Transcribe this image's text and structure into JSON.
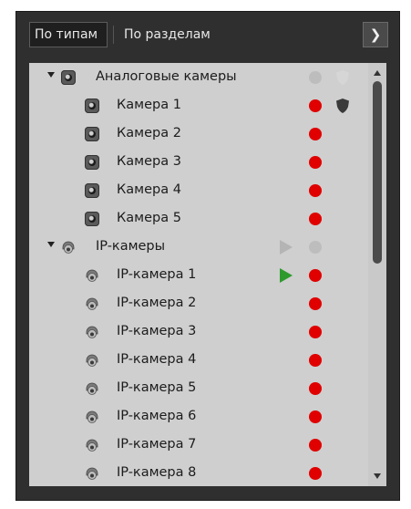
{
  "toolbar": {
    "tab_by_types": "По типам",
    "tab_by_sections": "По разделам",
    "next_glyph": "❯"
  },
  "tree": {
    "groups": [
      {
        "label": "Аналоговые камеры",
        "type": "analog",
        "expanded": true,
        "status_color": "#bdbdbd",
        "items": [
          {
            "label": "Камера 1",
            "status_color": "#e00000",
            "shield": true
          },
          {
            "label": "Камера 2",
            "status_color": "#e00000"
          },
          {
            "label": "Камера 3",
            "status_color": "#e00000"
          },
          {
            "label": "Камера 4",
            "status_color": "#e00000"
          },
          {
            "label": "Камера 5",
            "status_color": "#e00000"
          }
        ]
      },
      {
        "label": "IP-камеры",
        "type": "ip",
        "expanded": true,
        "status_color": "#bdbdbd",
        "items": [
          {
            "label": "IP-камера 1",
            "status_color": "#e00000",
            "play": true
          },
          {
            "label": "IP-камера 2",
            "status_color": "#e00000"
          },
          {
            "label": "IP-камера 3",
            "status_color": "#e00000"
          },
          {
            "label": "IP-камера 4",
            "status_color": "#e00000"
          },
          {
            "label": "IP-камера 5",
            "status_color": "#e00000"
          },
          {
            "label": "IP-камера 6",
            "status_color": "#e00000"
          },
          {
            "label": "IP-камера 7",
            "status_color": "#e00000"
          },
          {
            "label": "IP-камера 8",
            "status_color": "#e00000"
          }
        ]
      }
    ]
  },
  "colors": {
    "panel_bg": "#2f2f2f",
    "tree_bg": "#cfcfcf",
    "status_offline": "#e00000",
    "status_neutral": "#bdbdbd",
    "play_active": "#2e9a2e"
  }
}
